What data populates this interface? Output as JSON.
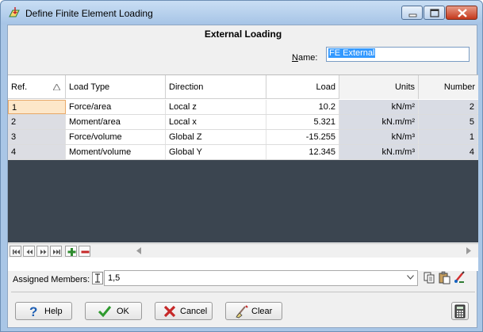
{
  "window": {
    "title": "Define Finite Element Loading",
    "icon": "fe-load-icon"
  },
  "dialog": {
    "heading": "External Loading",
    "name_label_prefix": "N",
    "name_label_rest": "ame:",
    "name_value": "FE External"
  },
  "grid": {
    "columns": [
      "Ref.",
      "Load Type",
      "Direction",
      "Load",
      "Units",
      "Number"
    ],
    "rows": [
      {
        "ref": "1",
        "type": "Force/area",
        "direction": "Local z",
        "load": "10.2",
        "units": "kN/m²",
        "number": "2"
      },
      {
        "ref": "2",
        "type": "Moment/area",
        "direction": "Local x",
        "load": "5.321",
        "units": "kN.m/m²",
        "number": "5"
      },
      {
        "ref": "3",
        "type": "Force/volume",
        "direction": "Global Z",
        "load": "-15.255",
        "units": "kN/m³",
        "number": "1"
      },
      {
        "ref": "4",
        "type": "Moment/volume",
        "direction": "Global Y",
        "load": "12.345",
        "units": "kN.m/m³",
        "number": "4"
      }
    ]
  },
  "members": {
    "label": "Assigned Members:",
    "value": "1,5"
  },
  "buttons": {
    "help": "Help",
    "ok": "OK",
    "cancel": "Cancel",
    "clear": "Clear"
  },
  "colors": {
    "accent": "#3399ff",
    "grid_empty": "#3b4550",
    "active_cell": "#fde7c9"
  }
}
